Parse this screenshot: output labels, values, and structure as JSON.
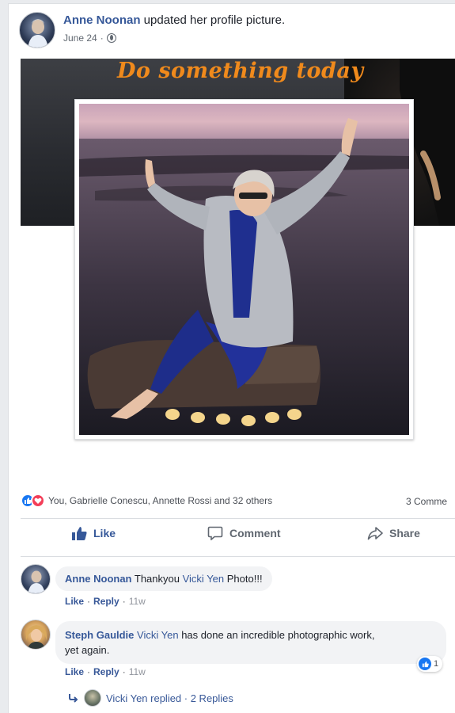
{
  "post": {
    "author": "Anne Noonan",
    "action_text": "updated her profile picture.",
    "date": "June 24",
    "date_separator": "·",
    "privacy_icon": "globe-icon"
  },
  "cover": {
    "text": "Do something today"
  },
  "reactions": {
    "summary": "You, Gabrielle Conescu, Annette Rossi and 32 others",
    "comments_count": "3 Comme",
    "icons": [
      "like-reaction-icon",
      "love-reaction-icon"
    ]
  },
  "actions": {
    "like": "Like",
    "comment": "Comment",
    "share": "Share"
  },
  "comments": [
    {
      "author": "Anne Noonan",
      "text_before": "Thankyou",
      "mention": "Vicki Yen",
      "text_after": "Photo!!!",
      "like_label": "Like",
      "reply_label": "Reply",
      "time": "11w"
    },
    {
      "author": "Steph Gauldie",
      "mention": "Vicki Yen",
      "text_line1": "has done an incredible photographic work,",
      "text_line2": "yet again.",
      "like_label": "Like",
      "reply_label": "Reply",
      "time": "11w",
      "like_count": "1"
    }
  ],
  "replies": {
    "text": "Vicki Yen replied · 2 Replies"
  },
  "colors": {
    "link": "#365899",
    "like_blue": "#1877f2",
    "love_red": "#f33e58",
    "cover_text": "#f08a1c"
  }
}
